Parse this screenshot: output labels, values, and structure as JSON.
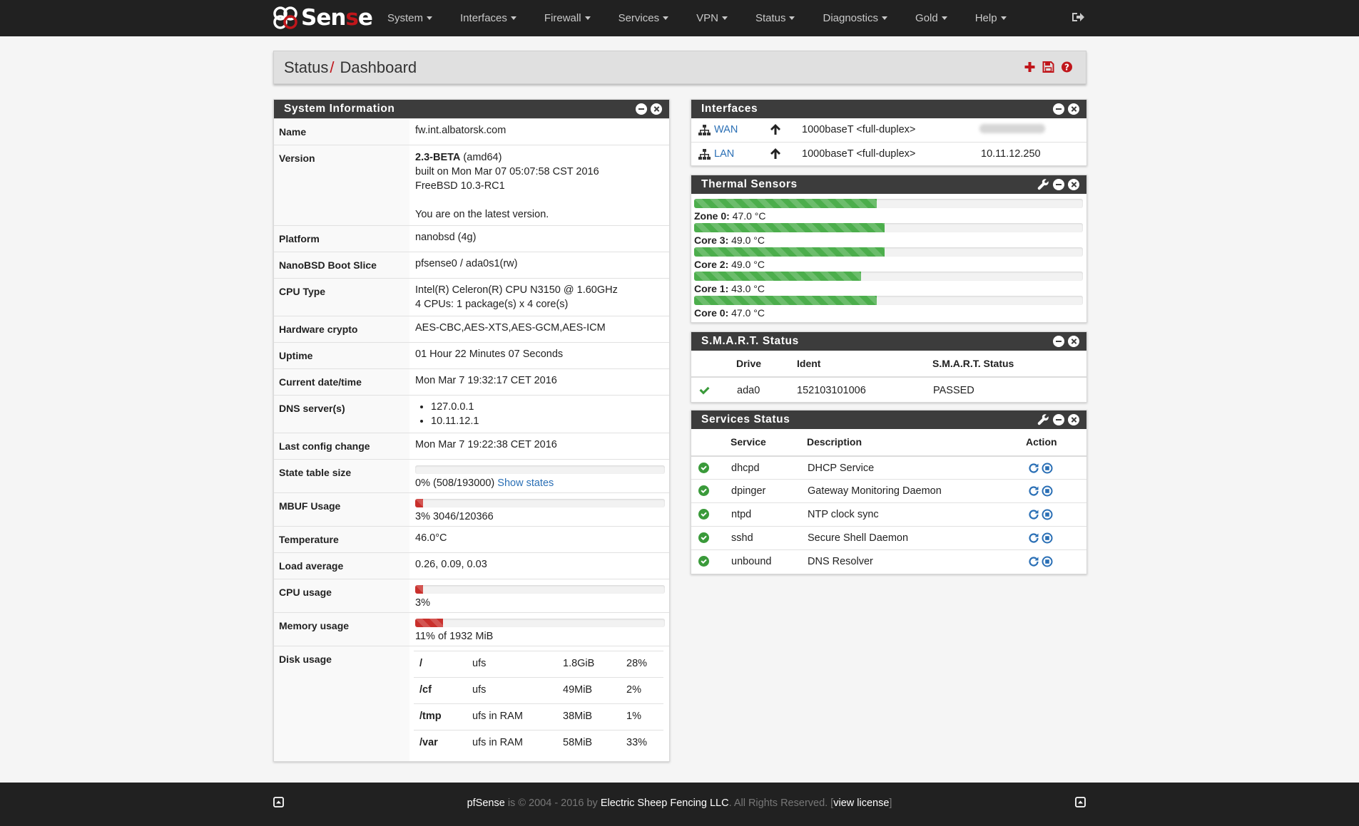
{
  "brand": {
    "name_part1": "Sen",
    "name_part2": "s",
    "name_part3": "e"
  },
  "nav": {
    "items": [
      {
        "label": "System"
      },
      {
        "label": "Interfaces"
      },
      {
        "label": "Firewall"
      },
      {
        "label": "Services"
      },
      {
        "label": "VPN"
      },
      {
        "label": "Status"
      },
      {
        "label": "Diagnostics"
      },
      {
        "label": "Gold"
      },
      {
        "label": "Help"
      }
    ]
  },
  "header": {
    "section": "Status",
    "separator": "/",
    "page": "Dashboard"
  },
  "system_info": {
    "title": "System Information",
    "rows": {
      "name": {
        "label": "Name",
        "value": "fw.int.albatorsk.com"
      },
      "version": {
        "label": "Version",
        "version": "2.3-BETA",
        "arch": "(amd64)",
        "built": "built on Mon Mar 07 05:07:58 CST 2016",
        "os": "FreeBSD 10.3-RC1",
        "status": "You are on the latest version."
      },
      "platform": {
        "label": "Platform",
        "value": "nanobsd (4g)"
      },
      "boot_slice": {
        "label": "NanoBSD Boot Slice",
        "value": "pfsense0 / ada0s1(rw)"
      },
      "cpu_type": {
        "label": "CPU Type",
        "line1": "Intel(R) Celeron(R) CPU N3150 @ 1.60GHz",
        "line2": "4 CPUs: 1 package(s) x 4 core(s)"
      },
      "hw_crypto": {
        "label": "Hardware crypto",
        "value": "AES-CBC,AES-XTS,AES-GCM,AES-ICM"
      },
      "uptime": {
        "label": "Uptime",
        "value": "01 Hour 22 Minutes 07 Seconds"
      },
      "datetime": {
        "label": "Current date/time",
        "value": "Mon Mar 7 19:32:17 CET 2016"
      },
      "dns": {
        "label": "DNS server(s)",
        "servers": [
          "127.0.0.1",
          "10.11.12.1"
        ]
      },
      "last_config": {
        "label": "Last config change",
        "value": "Mon Mar 7 19:22:38 CET 2016"
      },
      "state_table": {
        "label": "State table size",
        "value": "0% (508/193000)",
        "link": "Show states",
        "percent": 0
      },
      "mbuf": {
        "label": "MBUF Usage",
        "value": "3% 3046/120366",
        "percent": 3
      },
      "temperature": {
        "label": "Temperature",
        "value": "46.0°C"
      },
      "load": {
        "label": "Load average",
        "value": "0.26, 0.09, 0.03"
      },
      "cpu_usage": {
        "label": "CPU usage",
        "value": "3%",
        "percent": 3
      },
      "memory": {
        "label": "Memory usage",
        "value": "11% of 1932 MiB",
        "percent": 11
      },
      "disk": {
        "label": "Disk usage",
        "rows": [
          {
            "mount": "/",
            "type": "ufs",
            "size": "1.8GiB",
            "used": "28%"
          },
          {
            "mount": "/cf",
            "type": "ufs",
            "size": "49MiB",
            "used": "2%"
          },
          {
            "mount": "/tmp",
            "type": "ufs in RAM",
            "size": "38MiB",
            "used": "1%"
          },
          {
            "mount": "/var",
            "type": "ufs in RAM",
            "size": "58MiB",
            "used": "33%"
          }
        ]
      }
    }
  },
  "interfaces": {
    "title": "Interfaces",
    "rows": [
      {
        "name": "WAN",
        "media": "1000baseT <full-duplex>",
        "ip": ""
      },
      {
        "name": "LAN",
        "media": "1000baseT <full-duplex>",
        "ip": "10.11.12.250"
      }
    ]
  },
  "thermal": {
    "title": "Thermal Sensors",
    "sensors": [
      {
        "name": "Zone 0:",
        "value": "47.0 °C",
        "temp": 47.0
      },
      {
        "name": "Core 3:",
        "value": "49.0 °C",
        "temp": 49.0
      },
      {
        "name": "Core 2:",
        "value": "49.0 °C",
        "temp": 49.0
      },
      {
        "name": "Core 1:",
        "value": "43.0 °C",
        "temp": 43.0
      },
      {
        "name": "Core 0:",
        "value": "47.0 °C",
        "temp": 47.0
      }
    ]
  },
  "smart": {
    "title": "S.M.A.R.T. Status",
    "headers": {
      "drive": "Drive",
      "ident": "Ident",
      "status": "S.M.A.R.T. Status"
    },
    "rows": [
      {
        "drive": "ada0",
        "ident": "152103101006",
        "status": "PASSED"
      }
    ]
  },
  "services": {
    "title": "Services Status",
    "headers": {
      "service": "Service",
      "description": "Description",
      "action": "Action"
    },
    "rows": [
      {
        "service": "dhcpd",
        "description": "DHCP Service"
      },
      {
        "service": "dpinger",
        "description": "Gateway Monitoring Daemon"
      },
      {
        "service": "ntpd",
        "description": "NTP clock sync"
      },
      {
        "service": "sshd",
        "description": "Secure Shell Daemon"
      },
      {
        "service": "unbound",
        "description": "DNS Resolver"
      }
    ]
  },
  "footer": {
    "product": "pfSense",
    "is": "is ©",
    "years": "2004 - 2016 by",
    "company": "Electric Sheep Fencing LLC",
    "rights": ". All Rights Reserved. [",
    "license": "view license",
    "close": "]"
  },
  "colors": {
    "accent_red": "#c0161b",
    "navbar": "#212121",
    "panel_title": "#3c3c3c",
    "link": "#2a6fb5",
    "ok_green": "#4cae4c"
  },
  "icons": {
    "logout": "sign-out-icon",
    "add": "plus-icon",
    "save": "floppy-icon",
    "help": "question-circle-icon",
    "minimize": "minus-circle-icon",
    "close": "times-circle-icon",
    "settings": "wrench-icon",
    "network": "sitemap-icon",
    "link_up": "arrow-up-icon",
    "ok": "check-icon",
    "restart": "refresh-icon",
    "stop": "stop-circle-icon",
    "footer": "caret-square-up-icon"
  }
}
